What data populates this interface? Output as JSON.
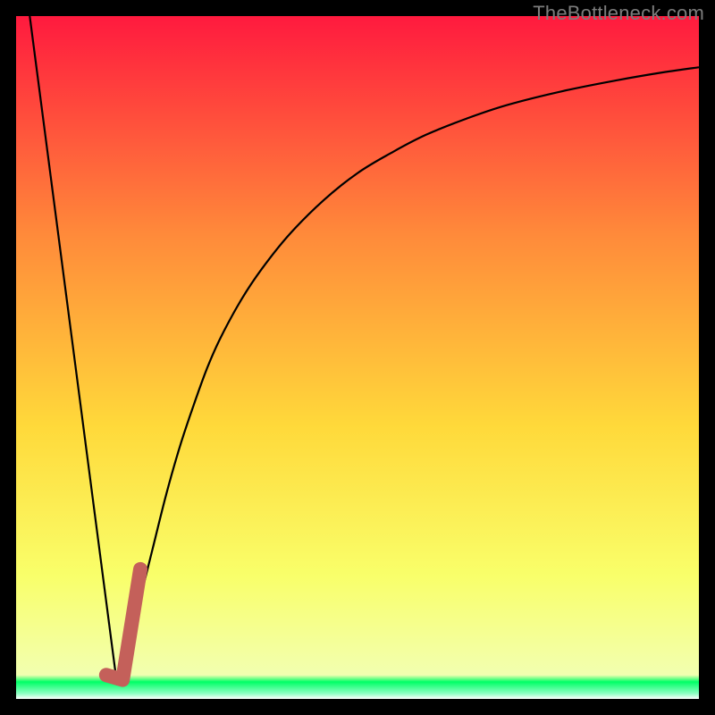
{
  "watermark": "TheBottleneck.com",
  "chart_data": {
    "type": "line",
    "title": "",
    "xlabel": "",
    "ylabel": "",
    "xlim": [
      0,
      100
    ],
    "ylim": [
      0,
      100
    ],
    "grid": false,
    "legend_position": "none",
    "background_gradient": {
      "top_color": "#ff1a3e",
      "mid_upper_color": "#ff8a3a",
      "mid_color": "#ffd93a",
      "mid_lower_color": "#f9ff6a",
      "bottom_band_color": "#00ff66",
      "bottom_color": "#ffffff"
    },
    "series": [
      {
        "name": "left-line",
        "stroke": "#000000",
        "x": [
          2,
          14.8
        ],
        "y": [
          100,
          2
        ]
      },
      {
        "name": "main-curve",
        "stroke": "#000000",
        "x": [
          14.8,
          16,
          17,
          18,
          19,
          20,
          22,
          24,
          26,
          28,
          30,
          33,
          36,
          40,
          45,
          50,
          55,
          60,
          66,
          72,
          80,
          88,
          95,
          100
        ],
        "y": [
          2,
          6,
          10,
          14,
          18,
          22,
          30,
          37,
          43,
          48.5,
          53,
          58.5,
          63,
          68,
          73,
          77,
          80,
          82.6,
          85,
          87,
          89,
          90.6,
          91.8,
          92.5
        ]
      },
      {
        "name": "accent-segment",
        "stroke": "#c4605a",
        "x": [
          13.2,
          15.6,
          18.2
        ],
        "y": [
          3.5,
          2.8,
          19
        ]
      }
    ]
  }
}
